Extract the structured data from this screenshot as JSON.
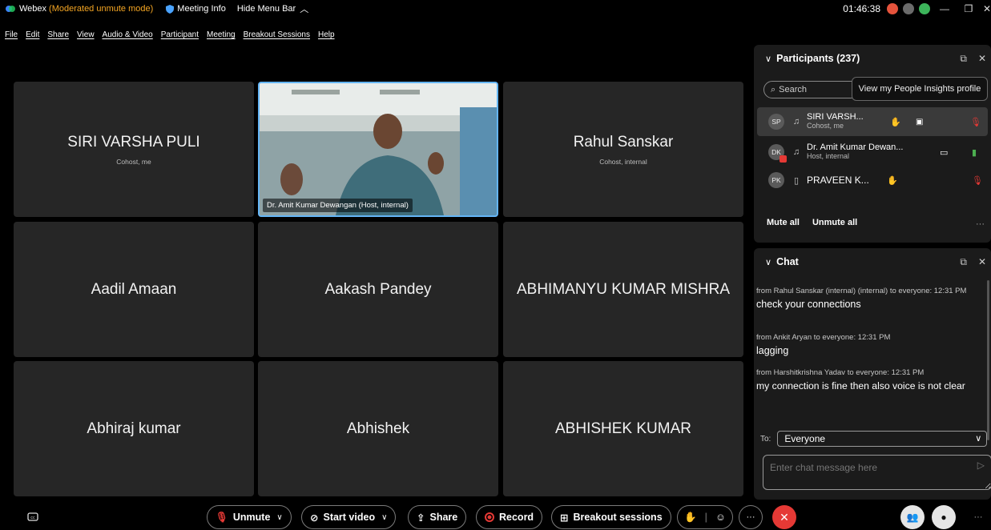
{
  "titlebar": {
    "brand": "Webex",
    "mode": "(Moderated unmute mode)",
    "meeting_info": "Meeting Info",
    "hide_menu": "Hide Menu Bar",
    "clock": "01:46:38"
  },
  "menu": [
    "File",
    "Edit",
    "Share",
    "View",
    "Audio & Video",
    "Participant",
    "Meeting",
    "Breakout Sessions",
    "Help"
  ],
  "tiles": [
    {
      "name": "SIRI VARSHA PULI",
      "sub": "Cohost, me"
    },
    {
      "name": "",
      "sub": "",
      "video_label": "Dr. Amit Kumar Dewangan (Host, internal)"
    },
    {
      "name": "Rahul Sanskar",
      "sub": "Cohost, internal"
    },
    {
      "name": "Aadil Amaan",
      "sub": ""
    },
    {
      "name": "Aakash Pandey",
      "sub": ""
    },
    {
      "name": "ABHIMANYU KUMAR MISHRA",
      "sub": ""
    },
    {
      "name": "Abhiraj kumar",
      "sub": ""
    },
    {
      "name": "Abhishek",
      "sub": ""
    },
    {
      "name": "ABHISHEK KUMAR",
      "sub": ""
    }
  ],
  "participants": {
    "title": "Participants (237)",
    "search_placeholder": "Search",
    "tooltip": "View my People Insights profile",
    "rows": [
      {
        "initials": "SP",
        "name": "SIRI VARSH...",
        "role": "Cohost, me"
      },
      {
        "initials": "DK",
        "name": "Dr. Amit Kumar Dewan...",
        "role": "Host, internal"
      },
      {
        "initials": "PK",
        "name": "PRAVEEN K...",
        "role": ""
      }
    ],
    "mute_all": "Mute all",
    "unmute_all": "Unmute all",
    "more": "···"
  },
  "chat": {
    "title": "Chat",
    "messages": [
      {
        "meta": "from Rahul Sanskar (internal) (internal) to everyone: 12:31 PM",
        "text": "check your connections"
      },
      {
        "meta": "from Ankit Aryan to everyone:   12:31 PM",
        "text": "lagging"
      },
      {
        "meta": "from Harshitkrishna Yadav to everyone:   12:31 PM",
        "text": "my connection is fine then also voice is not clear"
      }
    ],
    "to_label": "To:",
    "to_value": "Everyone",
    "input_placeholder": "Enter chat message here"
  },
  "controls": {
    "unmute": "Unmute",
    "start_video": "Start video",
    "share": "Share",
    "record": "Record",
    "breakout": "Breakout sessions",
    "more": "···",
    "more_right": "···"
  },
  "colors": {
    "tile_bg": "#262626",
    "active_border": "#64b5f6",
    "mode_text": "#f5a623",
    "leave_red": "#e53935",
    "panel_bg": "#1b1b1b"
  }
}
